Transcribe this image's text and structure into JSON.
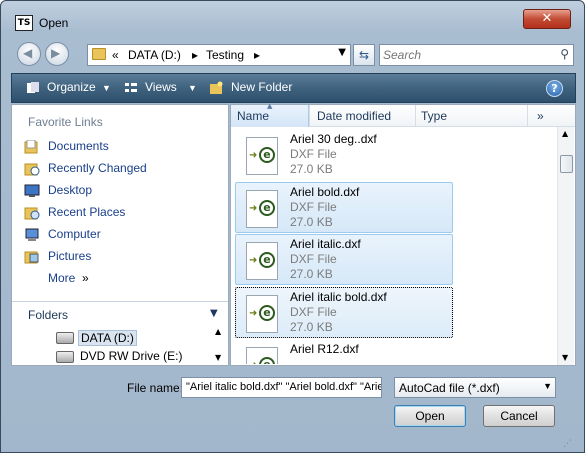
{
  "window": {
    "title": "Open",
    "app_icon_text": "TS",
    "close_glyph": "✕"
  },
  "nav": {
    "back_glyph": "◀",
    "forward_glyph": "▶",
    "breadcrumb": {
      "prefix": "«",
      "segments": [
        "DATA (D:)",
        "Testing"
      ],
      "separator": "▸"
    },
    "search_placeholder": "Search"
  },
  "toolbar": {
    "organize": "Organize",
    "views": "Views",
    "new_folder": "New Folder",
    "help": "?"
  },
  "sidebar": {
    "favorites_header": "Favorite Links",
    "favorites": [
      {
        "label": "Documents",
        "icon": "documents-icon"
      },
      {
        "label": "Recently Changed",
        "icon": "recently-changed-icon"
      },
      {
        "label": "Desktop",
        "icon": "desktop-icon"
      },
      {
        "label": "Recent Places",
        "icon": "recent-places-icon"
      },
      {
        "label": "Computer",
        "icon": "computer-icon"
      },
      {
        "label": "Pictures",
        "icon": "pictures-icon"
      }
    ],
    "more": "More",
    "more_glyph": "»",
    "folders_header": "Folders",
    "tree": [
      {
        "label": "DATA (D:)",
        "selected": true
      },
      {
        "label": "DVD RW Drive (E:)",
        "selected": false
      }
    ]
  },
  "list": {
    "columns": [
      "Name",
      "Date modified",
      "Type"
    ],
    "more_glyph": "»",
    "files": [
      {
        "name": "Ariel 30 deg..dxf",
        "type": "DXF File",
        "size": "27.0 KB",
        "state": "normal"
      },
      {
        "name": "Ariel bold.dxf",
        "type": "DXF File",
        "size": "27.0 KB",
        "state": "selected"
      },
      {
        "name": "Ariel italic.dxf",
        "type": "DXF File",
        "size": "27.0 KB",
        "state": "selected"
      },
      {
        "name": "Ariel italic bold.dxf",
        "type": "DXF File",
        "size": "27.0 KB",
        "state": "focused"
      },
      {
        "name": "Ariel R12.dxf",
        "type": "",
        "size": "",
        "state": "normal"
      }
    ]
  },
  "footer": {
    "file_name_label": "File name:",
    "file_name_value": "\"Ariel italic bold.dxf\" \"Ariel bold.dxf\" \"Ariel",
    "filter": "AutoCad file (*.dxf)",
    "open": "Open",
    "cancel": "Cancel"
  },
  "colors": {
    "accent": "#2e506d",
    "link": "#1a3f8a",
    "selection": "#d6e8f8"
  }
}
